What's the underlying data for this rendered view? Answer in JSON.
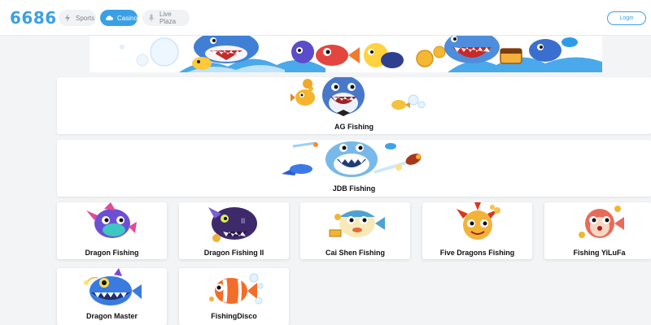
{
  "header": {
    "logo": "6686",
    "tabs": [
      {
        "label": "Sports",
        "icon": "bolt-icon",
        "active": false
      },
      {
        "label": "Casino",
        "icon": "cloud-icon",
        "active": true
      },
      {
        "label": "Live Plaza",
        "icon": "microphone-icon",
        "active": false
      }
    ],
    "login_label": "Login"
  },
  "colors": {
    "accent": "#3aa0e6",
    "page_background": "#f3f4f6"
  },
  "banner": {
    "icon": "fish-banner-art"
  },
  "featured": [
    {
      "label": "AG Fishing",
      "icon": "shark-fish-art"
    },
    {
      "label": "JDB Fishing",
      "icon": "shark-rocket-art"
    }
  ],
  "games": [
    {
      "name": "Dragon Fishing",
      "icon": "purple-fish-art"
    },
    {
      "name": "Dragon Fishing II",
      "icon": "dark-monster-fish-art"
    },
    {
      "name": "Cai Shen Fishing",
      "icon": "puffer-fish-art"
    },
    {
      "name": "Five Dragons Fishing",
      "icon": "red-lion-fish-art"
    },
    {
      "name": "Fishing YiLuFa",
      "icon": "red-puffer-fish-art"
    },
    {
      "name": "Dragon Master",
      "icon": "anglerfish-art"
    },
    {
      "name": "FishingDisco",
      "icon": "clownfish-art"
    }
  ]
}
